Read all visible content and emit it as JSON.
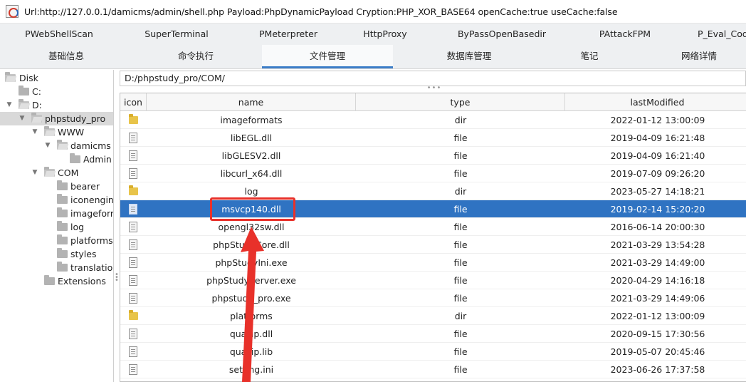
{
  "window": {
    "title": "Url:http://127.0.0.1/damicms/admin/shell.php Payload:PhpDynamicPayload Cryption:PHP_XOR_BASE64 openCache:true useCache:false"
  },
  "plugins": [
    "PWebShellScan",
    "SuperTerminal",
    "PMeterpreter",
    "HttpProxy",
    "ByPassOpenBasedir",
    "PAttackFPM",
    "P_Eval_Code"
  ],
  "main_tabs": {
    "items": [
      "基础信息",
      "命令执行",
      "文件管理",
      "数据库管理",
      "笔记",
      "网络详情"
    ],
    "active": "文件管理"
  },
  "tree": {
    "nodes": [
      {
        "label": "Disk"
      },
      {
        "label": "C:"
      },
      {
        "label": "D:"
      },
      {
        "label": "phpstudy_pro"
      },
      {
        "label": "WWW"
      },
      {
        "label": "damicms"
      },
      {
        "label": "Admin"
      },
      {
        "label": "COM"
      },
      {
        "label": "bearer"
      },
      {
        "label": "iconengines"
      },
      {
        "label": "imageformats"
      },
      {
        "label": "log"
      },
      {
        "label": "platforms"
      },
      {
        "label": "styles"
      },
      {
        "label": "translations"
      },
      {
        "label": "Extensions"
      }
    ],
    "selected": "phpstudy_pro"
  },
  "path": "D:/phpstudy_pro/COM/",
  "file_table": {
    "headers": {
      "icon": "icon",
      "name": "name",
      "type": "type",
      "lastModified": "lastModified"
    },
    "rows": [
      {
        "name": "imageformats",
        "type": "dir",
        "modified": "2022-01-12 13:00:09",
        "icon": "folder-icon"
      },
      {
        "name": "libEGL.dll",
        "type": "file",
        "modified": "2019-04-09 16:21:48",
        "icon": "file-icon"
      },
      {
        "name": "libGLESV2.dll",
        "type": "file",
        "modified": "2019-04-09 16:21:40",
        "icon": "file-icon"
      },
      {
        "name": "libcurl_x64.dll",
        "type": "file",
        "modified": "2019-07-09 09:26:20",
        "icon": "file-icon"
      },
      {
        "name": "log",
        "type": "dir",
        "modified": "2023-05-27 14:18:21",
        "icon": "folder-icon"
      },
      {
        "name": "msvcp140.dll",
        "type": "file",
        "modified": "2019-02-14 15:20:20",
        "icon": "file-icon",
        "selected": true
      },
      {
        "name": "opengl32sw.dll",
        "type": "file",
        "modified": "2016-06-14 20:00:30",
        "icon": "file-icon"
      },
      {
        "name": "phpStudyCore.dll",
        "type": "file",
        "modified": "2021-03-29 13:54:28",
        "icon": "file-icon"
      },
      {
        "name": "phpStudyIni.exe",
        "type": "file",
        "modified": "2021-03-29 14:49:00",
        "icon": "file-icon"
      },
      {
        "name": "phpStudyServer.exe",
        "type": "file",
        "modified": "2020-04-29 14:16:18",
        "icon": "file-icon"
      },
      {
        "name": "phpstudy_pro.exe",
        "type": "file",
        "modified": "2021-03-29 14:49:06",
        "icon": "file-icon"
      },
      {
        "name": "platforms",
        "type": "dir",
        "modified": "2022-01-12 13:00:09",
        "icon": "folder-icon"
      },
      {
        "name": "quazip.dll",
        "type": "file",
        "modified": "2020-09-15 17:30:56",
        "icon": "file-icon"
      },
      {
        "name": "quazip.lib",
        "type": "file",
        "modified": "2019-05-07 20:45:46",
        "icon": "file-icon"
      },
      {
        "name": "setting.ini",
        "type": "file",
        "modified": "2023-06-26 17:37:58",
        "icon": "file-icon"
      }
    ]
  },
  "colors": {
    "selection": "#2f73c2",
    "active_tab_underline": "#3d7ec8",
    "annotation": "#e8312a"
  }
}
